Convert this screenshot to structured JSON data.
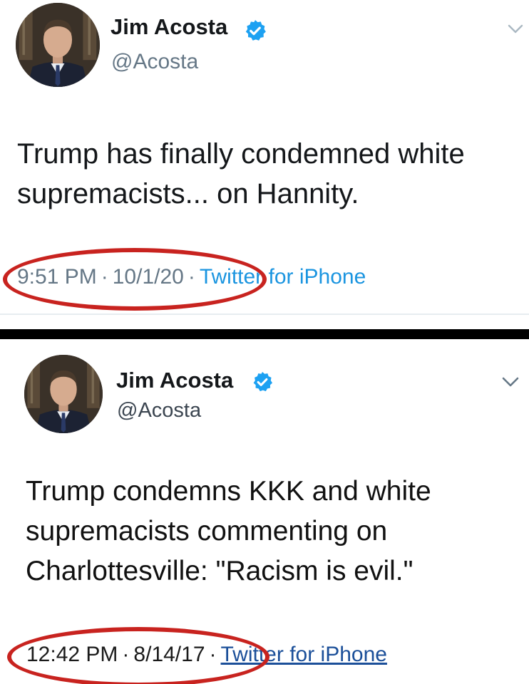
{
  "colors": {
    "verified": "#1da1f2",
    "annotation": "#c8231f",
    "link": "#1b95e0",
    "divider": "#000000"
  },
  "tweets": [
    {
      "display_name": "Jim Acosta",
      "handle": "@Acosta",
      "text": "Trump has finally condemned white\nsupremacists... on Hannity.",
      "time": "9:51 PM",
      "date": "10/1/20",
      "separator": "·",
      "source": "Twitter for iPhone",
      "icons": [
        "avatar",
        "verified-badge-icon",
        "chevron-down-icon"
      ]
    },
    {
      "display_name": "Jim Acosta",
      "handle": "@Acosta",
      "text": "Trump condemns KKK and white\nsupremacists commenting on\nCharlottesville: \"Racism is evil.\"",
      "time": "12:42 PM",
      "date": "8/14/17",
      "separator": "·",
      "source": "Twitter for iPhone",
      "icons": [
        "avatar",
        "verified-badge-icon",
        "chevron-down-icon"
      ]
    }
  ]
}
